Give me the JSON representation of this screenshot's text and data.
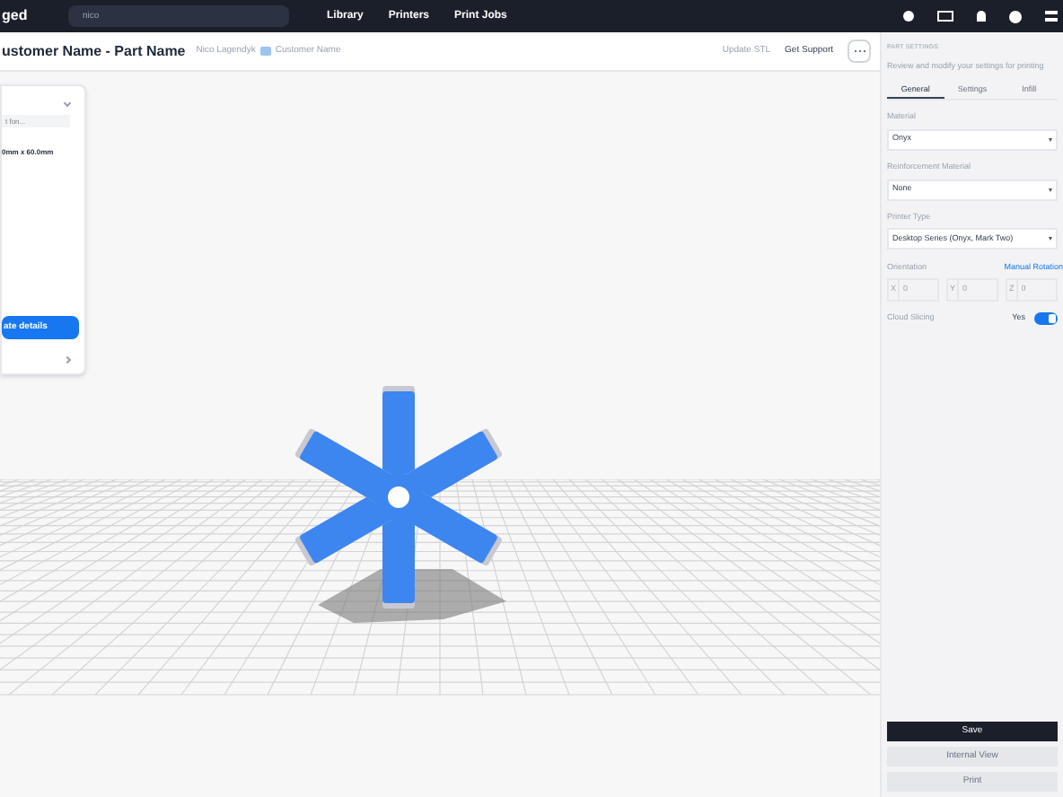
{
  "nav": {
    "logo": "ged",
    "search": {
      "value": "nico"
    },
    "links": [
      "Library",
      "Printers",
      "Print Jobs"
    ]
  },
  "toolbar": {
    "title": "ustomer Name - Part Name",
    "owner": "Nico Lagendyk",
    "folder": "Customer Name",
    "actions": [
      {
        "label": "Update STL",
        "disabled": true
      },
      {
        "label": "Get Support",
        "disabled": false
      }
    ]
  },
  "details_card": {
    "field": {
      "placeholder": "t fon..."
    },
    "dimensions": "0mm x 60.0mm",
    "button": "ate details"
  },
  "panel": {
    "heading": "PART SETTINGS",
    "subtitle": "Review and modify your settings for printing",
    "tabs": [
      {
        "label": "General",
        "selected": true
      },
      {
        "label": "Settings",
        "selected": false
      },
      {
        "label": "Infill",
        "selected": false
      }
    ],
    "selects": [
      {
        "label": "Material",
        "value": "Onyx"
      },
      {
        "label": "Reinforcement Material",
        "value": "None"
      },
      {
        "label": "Printer Type",
        "value": "Desktop Series (Onyx, Mark Two)"
      }
    ],
    "orientation": {
      "label": "Orientation",
      "link": "Manual Rotation",
      "axes": [
        {
          "axis": "X",
          "placeholder": "0"
        },
        {
          "axis": "Y",
          "placeholder": "0"
        },
        {
          "axis": "Z",
          "placeholder": "0"
        }
      ]
    },
    "cloud_slicing": {
      "label": "Cloud Slicing",
      "value": "Yes",
      "on": true
    },
    "buttons": [
      {
        "label": "Save",
        "disabled": false
      },
      {
        "label": "Internal View",
        "disabled": true
      },
      {
        "label": "Print",
        "disabled": true
      }
    ]
  }
}
